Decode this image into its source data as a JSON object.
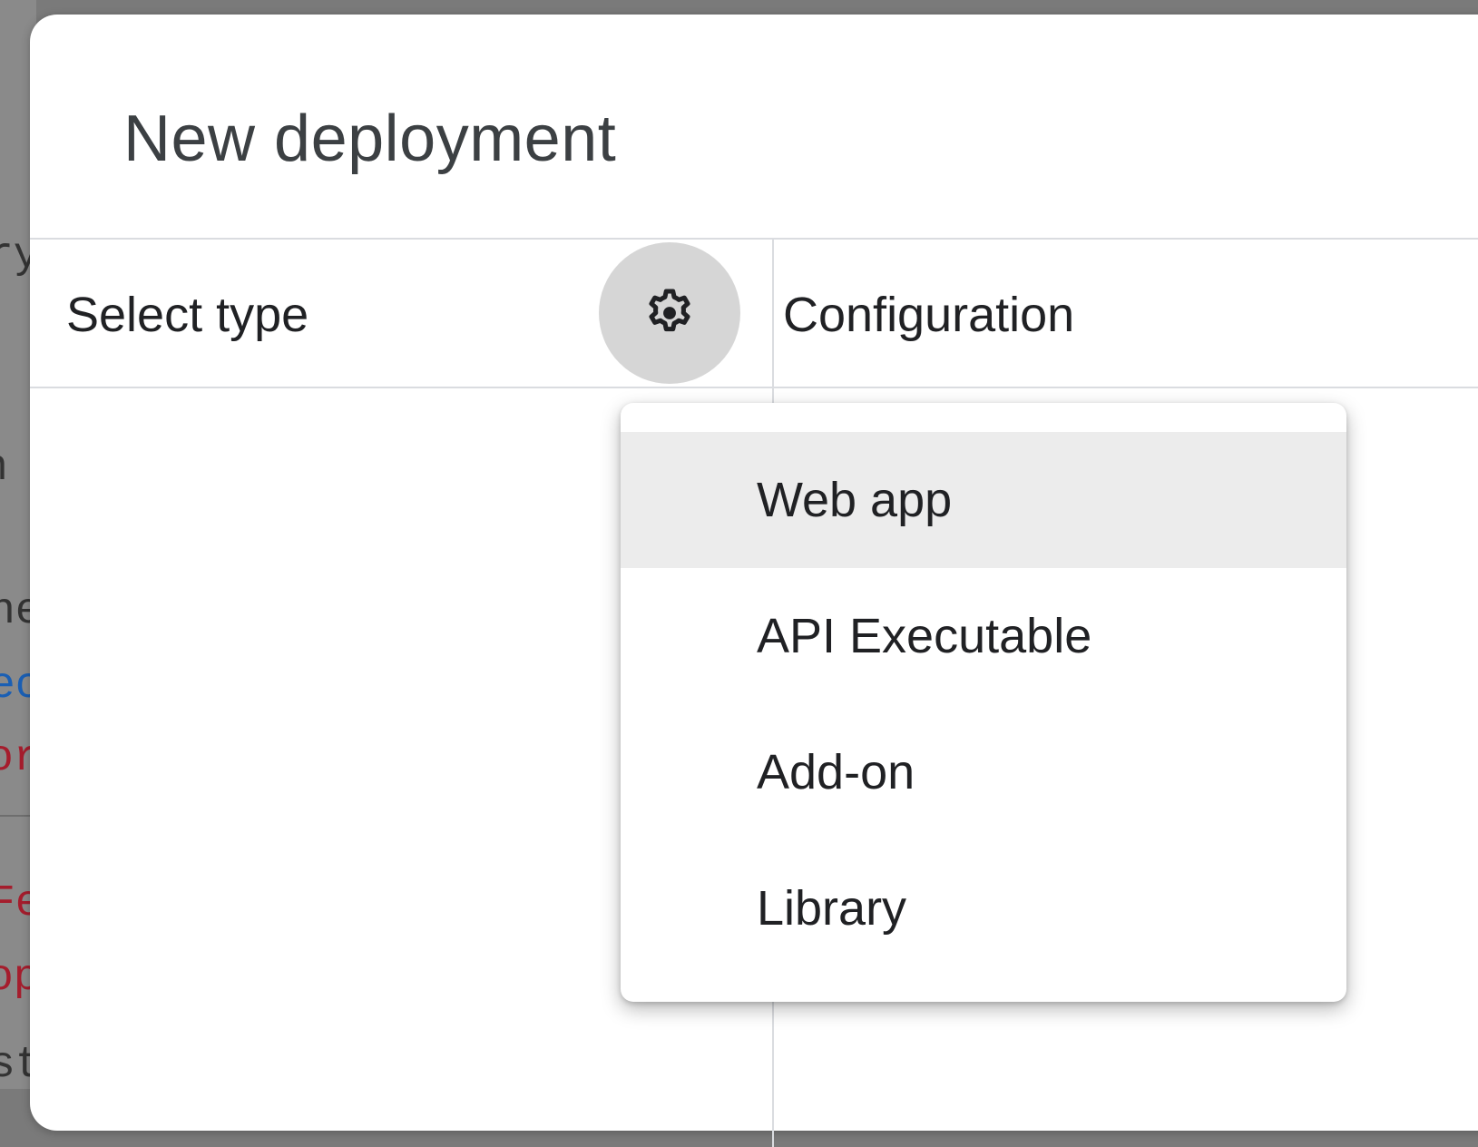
{
  "background": {
    "fragments": [
      "ry",
      "n",
      "ne",
      "ec",
      "or",
      "Fe",
      "op",
      "st"
    ]
  },
  "dialog": {
    "title": "New deployment",
    "left_header": "Select type",
    "right_header": "Configuration",
    "settings_icon": "gear-icon"
  },
  "menu": {
    "items": [
      {
        "label": "Web app",
        "highlighted": true
      },
      {
        "label": "API Executable",
        "highlighted": false
      },
      {
        "label": "Add-on",
        "highlighted": false
      },
      {
        "label": "Library",
        "highlighted": false
      }
    ]
  },
  "colors": {
    "backdrop": "#7a7a7a",
    "dialog_bg": "#ffffff",
    "title_text": "#3c4043",
    "divider": "#dadce0",
    "icon_button_bg": "#d6d6d6",
    "menu_highlight": "#ececec",
    "fragment_blue": "#1a5fb4",
    "fragment_red": "#a51d2d"
  }
}
